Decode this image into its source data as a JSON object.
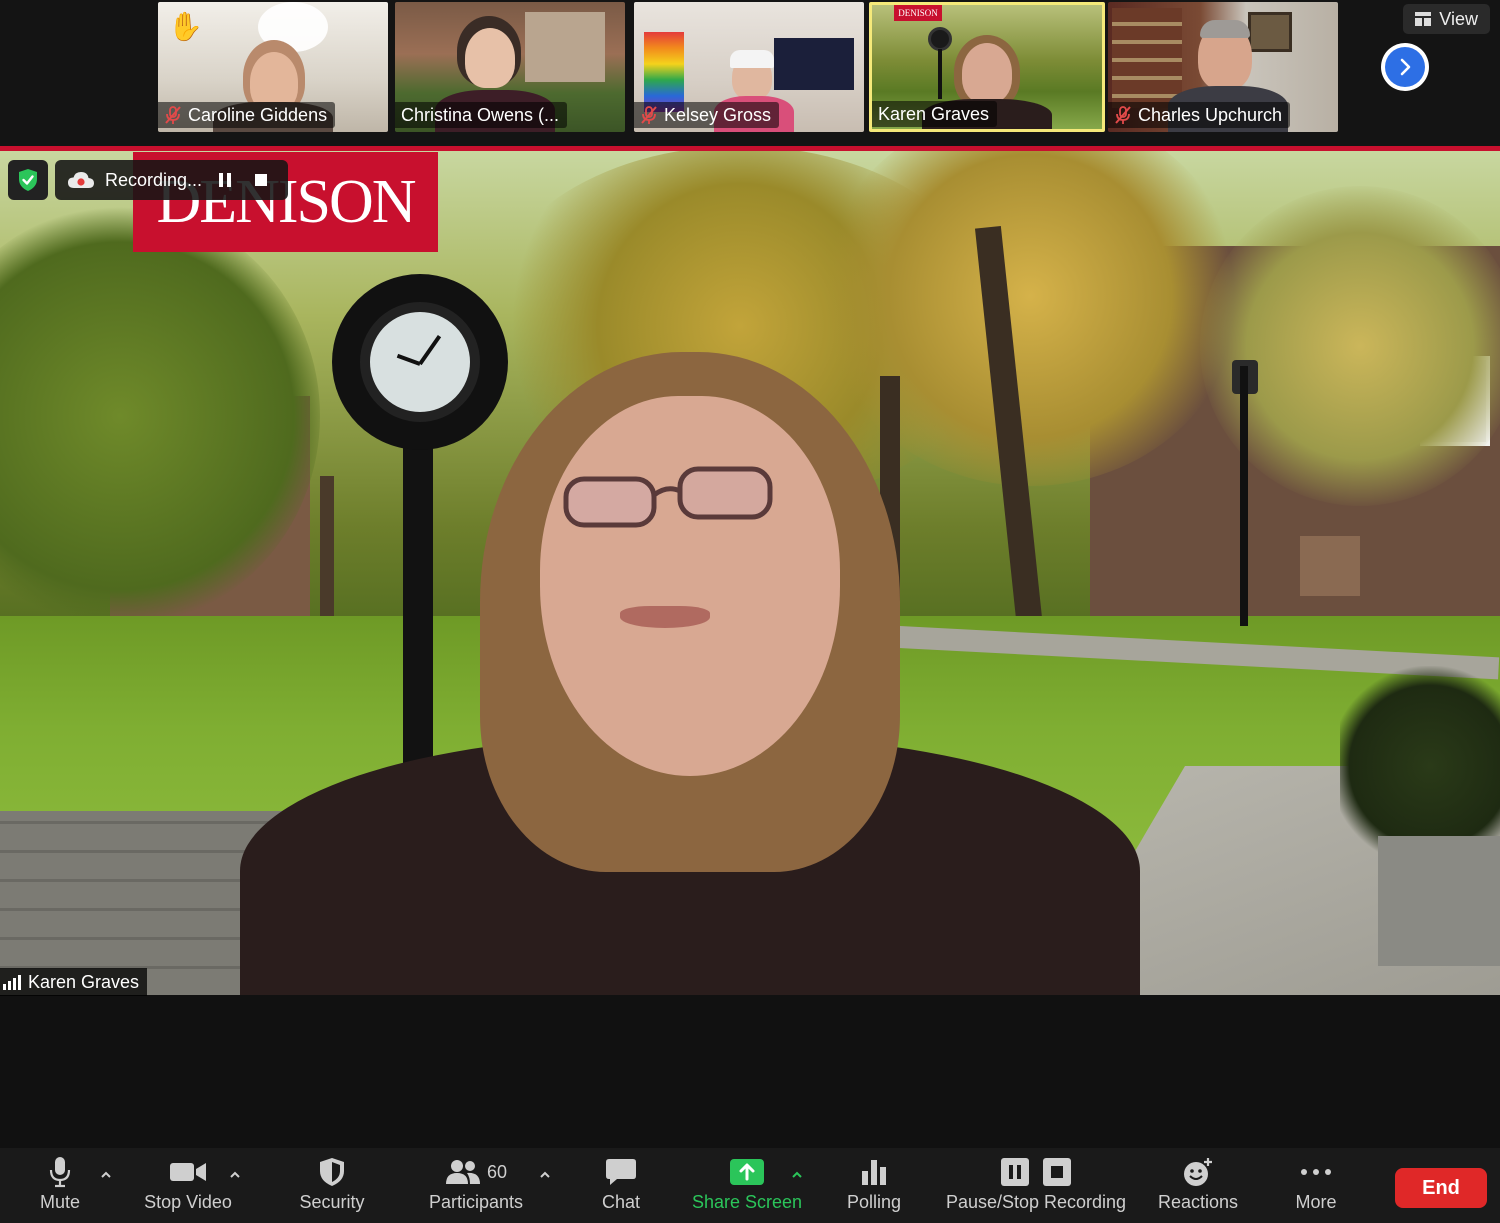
{
  "participants": [
    {
      "name": "Caroline Giddens",
      "muted": true,
      "hand_raised": true
    },
    {
      "name": "Christina Owens (...",
      "muted": false,
      "hand_raised": false
    },
    {
      "name": "Kelsey Gross",
      "muted": true,
      "hand_raised": false
    },
    {
      "name": "Karen Graves",
      "muted": false,
      "hand_raised": false,
      "active_speaker": true
    },
    {
      "name": "Charles Upchurch",
      "muted": true,
      "hand_raised": false
    }
  ],
  "tile_background_text": {
    "karen_banner": "DENISON"
  },
  "view_button": {
    "label": "View",
    "icon": "grid-icon"
  },
  "next_page_icon": "chevron-right-icon",
  "main_video": {
    "speaker_name": "Karen Graves",
    "background_banner": "DENISON",
    "recording": {
      "label": "Recording...",
      "status": "recording"
    }
  },
  "toolbar": {
    "mute": {
      "label": "Mute",
      "icon": "microphone-icon"
    },
    "stop_video": {
      "label": "Stop Video",
      "icon": "video-camera-icon"
    },
    "security": {
      "label": "Security",
      "icon": "shield-icon"
    },
    "participants": {
      "label": "Participants",
      "count": "60",
      "icon": "people-icon"
    },
    "chat": {
      "label": "Chat",
      "icon": "chat-bubble-icon"
    },
    "share_screen": {
      "label": "Share Screen",
      "icon": "share-arrow-icon"
    },
    "polling": {
      "label": "Polling",
      "icon": "bar-chart-icon"
    },
    "pause_stop_recording": {
      "label": "Pause/Stop Recording",
      "icon": "pause-stop-icon"
    },
    "reactions": {
      "label": "Reactions",
      "icon": "emoji-plus-icon"
    },
    "more": {
      "label": "More",
      "icon": "ellipsis-icon"
    },
    "end": {
      "label": "End"
    }
  },
  "colors": {
    "accent_red": "#c8102e",
    "share_green": "#2bc55a",
    "end_red": "#e02828",
    "active_border": "#f5e97a",
    "next_blue": "#2d6fe5"
  }
}
